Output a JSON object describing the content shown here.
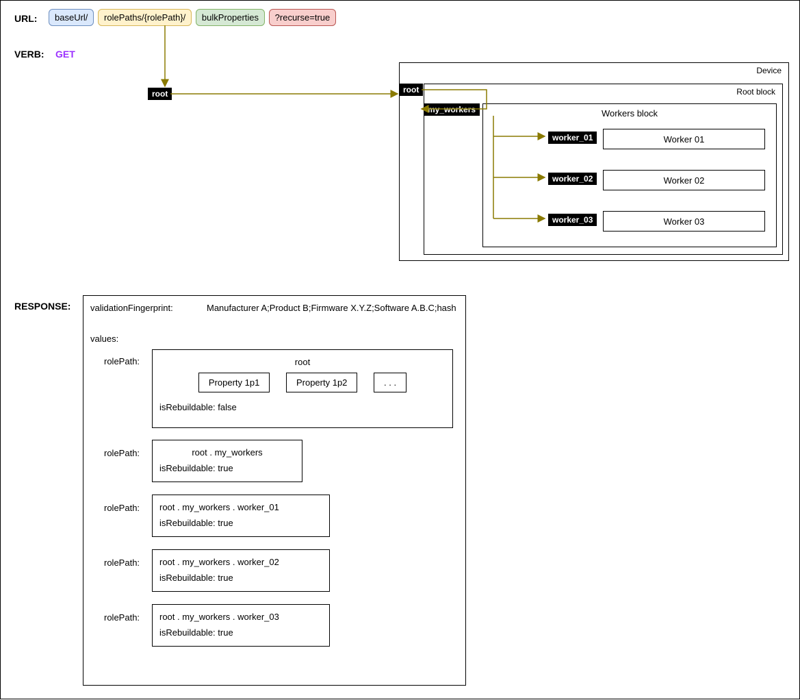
{
  "url_label": "URL:",
  "url_parts": {
    "baseUrl": "baseUrl/",
    "rolePaths": "rolePaths/{rolePath}/",
    "bulkProperties": "bulkProperties",
    "recurse": "?recurse=true"
  },
  "verb_label": "VERB:",
  "verb_value": "GET",
  "root_tag_left": "root",
  "device": {
    "title": "Device",
    "root_block_title": "Root block",
    "root_tag": "root",
    "my_workers_tag": "my_workers",
    "workers_block_title": "Workers block",
    "workers": [
      {
        "tag": "worker_01",
        "label": "Worker 01"
      },
      {
        "tag": "worker_02",
        "label": "Worker 02"
      },
      {
        "tag": "worker_03",
        "label": "Worker 03"
      }
    ]
  },
  "response_label": "RESPONSE:",
  "response": {
    "validationFingerprint_label": "validationFingerprint:",
    "validationFingerprint_value": "Manufacturer A;Product B;Firmware X.Y.Z;Software A.B.C;hash",
    "values_label": "values:",
    "rolePath_label": "rolePath:",
    "blocks": [
      {
        "title": "root",
        "properties": [
          "Property 1p1",
          "Property 1p2",
          ". . ."
        ],
        "isRebuildable": "isRebuildable: false"
      },
      {
        "title": "root . my_workers",
        "isRebuildable": "isRebuildable: true"
      },
      {
        "title": "root . my_workers . worker_01",
        "isRebuildable": "isRebuildable: true"
      },
      {
        "title": "root . my_workers . worker_02",
        "isRebuildable": "isRebuildable: true"
      },
      {
        "title": "root . my_workers . worker_03",
        "isRebuildable": "isRebuildable: true"
      }
    ]
  }
}
